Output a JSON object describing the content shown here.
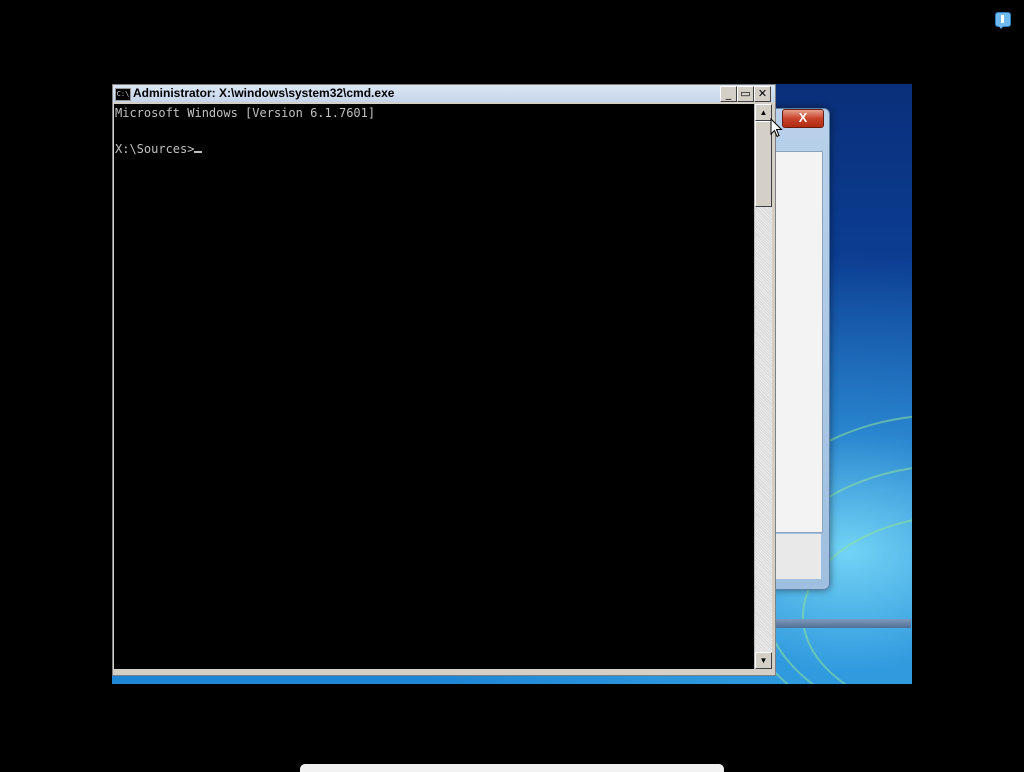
{
  "cmd_window": {
    "title": "Administrator: X:\\windows\\system32\\cmd.exe",
    "icon_label": "C:\\",
    "buttons": {
      "minimize": "_",
      "maximize": "▭",
      "close": "✕"
    },
    "console_lines": [
      "Microsoft Windows [Version 6.1.7601]",
      "",
      "X:\\Sources>"
    ]
  },
  "setup_dialog": {
    "close_label": "X"
  },
  "scrollbar": {
    "up": "▲",
    "down": "▼"
  }
}
